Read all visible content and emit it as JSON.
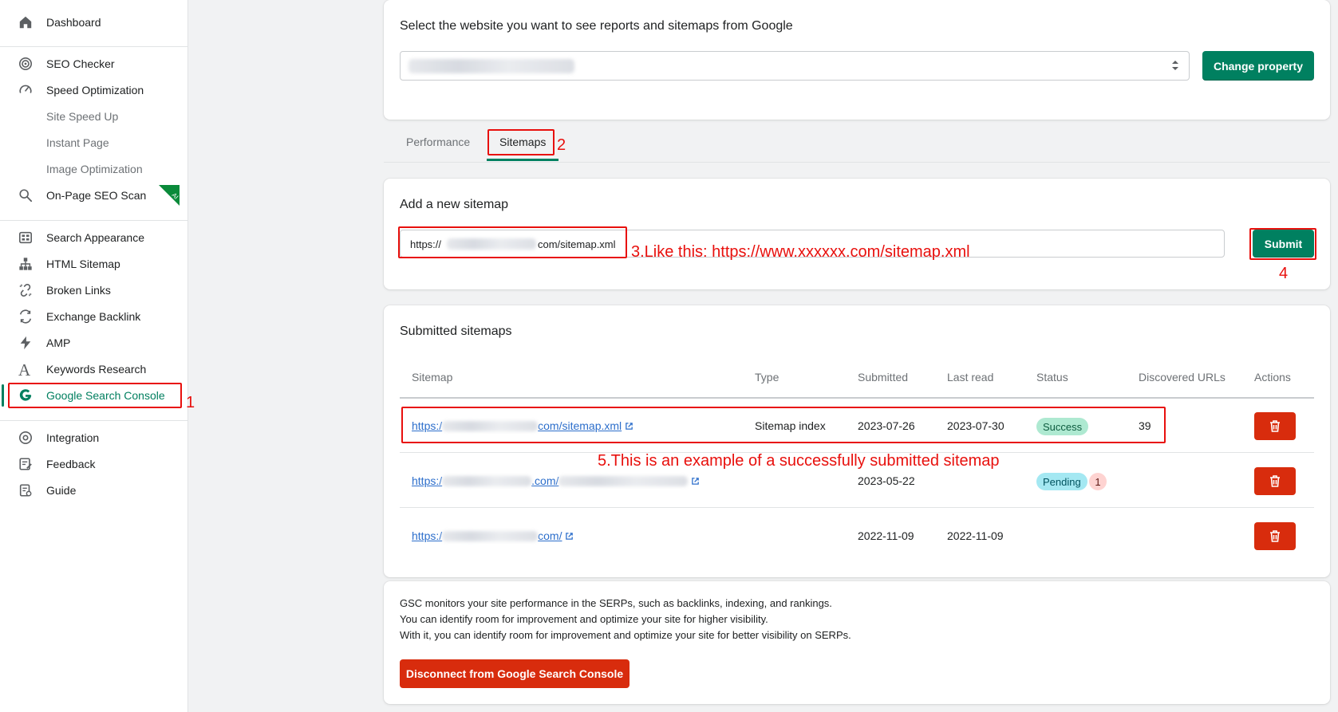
{
  "sidebar": {
    "items": [
      {
        "label": "Dashboard",
        "icon": "home-icon"
      },
      {
        "label": "SEO Checker",
        "icon": "target-icon"
      },
      {
        "label": "Speed Optimization",
        "icon": "speedometer-icon"
      },
      {
        "label": "Site Speed Up"
      },
      {
        "label": "Instant Page"
      },
      {
        "label": "Image Optimization"
      },
      {
        "label": "On-Page SEO Scan",
        "icon": "search-icon",
        "badge": "AI"
      },
      {
        "label": "Search Appearance",
        "icon": "grid-icon"
      },
      {
        "label": "HTML Sitemap",
        "icon": "sitemap-icon"
      },
      {
        "label": "Broken Links",
        "icon": "broken-link-icon"
      },
      {
        "label": "Exchange Backlink",
        "icon": "exchange-icon"
      },
      {
        "label": "AMP",
        "icon": "lightning-icon"
      },
      {
        "label": "Keywords Research",
        "icon": "letter-a-icon"
      },
      {
        "label": "Google Search Console",
        "icon": "google-g-icon"
      },
      {
        "label": "Integration",
        "icon": "integration-icon"
      },
      {
        "label": "Feedback",
        "icon": "feedback-icon"
      },
      {
        "label": "Guide",
        "icon": "guide-icon"
      }
    ]
  },
  "property": {
    "title": "Select the website you want to see reports and sitemaps from Google",
    "change_button": "Change property"
  },
  "tabs": [
    {
      "label": "Performance"
    },
    {
      "label": "Sitemaps",
      "active": true
    }
  ],
  "add_sitemap": {
    "title": "Add a new sitemap",
    "input_prefix": "https://",
    "input_suffix": "com/sitemap.xml",
    "submit": "Submit"
  },
  "submitted": {
    "title": "Submitted sitemaps",
    "columns": [
      "Sitemap",
      "Type",
      "Submitted",
      "Last read",
      "Status",
      "Discovered URLs",
      "Actions"
    ],
    "rows": [
      {
        "prefix": "https:/",
        "suffix": "com/sitemap.xml",
        "type": "Sitemap index",
        "submitted": "2023-07-26",
        "last_read": "2023-07-30",
        "status": "Success",
        "discovered": "39"
      },
      {
        "prefix": "https:/",
        "suffix": ".com/",
        "type": "",
        "submitted": "2023-05-22",
        "last_read": "",
        "status": "Pending",
        "count": "1",
        "discovered": ""
      },
      {
        "prefix": "https:/",
        "suffix": "com/",
        "type": "",
        "submitted": "2022-11-09",
        "last_read": "2022-11-09",
        "status": "",
        "discovered": ""
      }
    ]
  },
  "gsc_note": {
    "lines": [
      "GSC monitors your site performance in the SERPs, such as backlinks, indexing, and rankings.",
      "You can identify room for improvement and optimize your site for higher visibility.",
      "With it, you can identify room for improvement and optimize your site for better visibility on SERPs."
    ],
    "disconnect": "Disconnect from Google Search Console"
  },
  "annotations": {
    "a1": "1",
    "a2": "2",
    "a3": "3.Like this: https://www.xxxxxx.com/sitemap.xml",
    "a4": "4",
    "a5": "5.This is an example of a successfully submitted sitemap"
  },
  "colors": {
    "accent": "#008060",
    "danger": "#d82c0d",
    "annotation": "#e8100d",
    "link": "#2c6ecb"
  }
}
